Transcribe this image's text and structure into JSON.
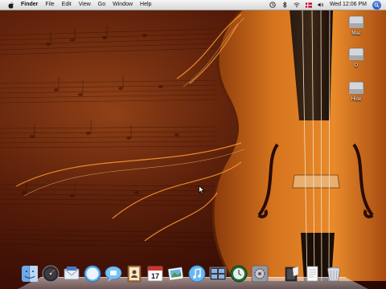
{
  "menubar": {
    "app_name": "Finder",
    "items": [
      "File",
      "Edit",
      "View",
      "Go",
      "Window",
      "Help"
    ],
    "clock": "Wed 12:06 PM"
  },
  "icons": {
    "apple": "apple-logo-icon",
    "time_machine": "time-machine-icon",
    "bluetooth": "bluetooth-icon",
    "wifi": "wifi-icon",
    "flag": "input-flag-icon",
    "volume": "volume-icon",
    "spotlight": "spotlight-icon"
  },
  "desktop": {
    "drives": [
      {
        "label": "Mac",
        "icon": "hard-drive-icon"
      },
      {
        "label": "D",
        "icon": "hard-drive-icon"
      },
      {
        "label": "Hide",
        "icon": "hard-drive-icon"
      }
    ]
  },
  "dock": {
    "items": [
      {
        "icon": "finder-icon"
      },
      {
        "icon": "dashboard-icon"
      },
      {
        "icon": "mail-icon"
      },
      {
        "icon": "safari-icon"
      },
      {
        "icon": "ichat-icon"
      },
      {
        "icon": "address-book-icon"
      },
      {
        "icon": "ical-icon",
        "text": "17"
      },
      {
        "icon": "iphoto-icon"
      },
      {
        "icon": "itunes-icon"
      },
      {
        "icon": "spaces-icon"
      },
      {
        "icon": "time-machine-icon"
      },
      {
        "icon": "system-preferences-icon"
      },
      {
        "icon": "stack-folder-icon"
      },
      {
        "icon": "documents-stack-icon"
      },
      {
        "icon": "trash-icon"
      }
    ]
  },
  "colors": {
    "wallpaper_dark": "#2a0a03",
    "wallpaper_mid": "#7a3310",
    "violin_body": "#c86818",
    "violin_highlight": "#f0a040",
    "menubar": "#e8e8e8"
  }
}
